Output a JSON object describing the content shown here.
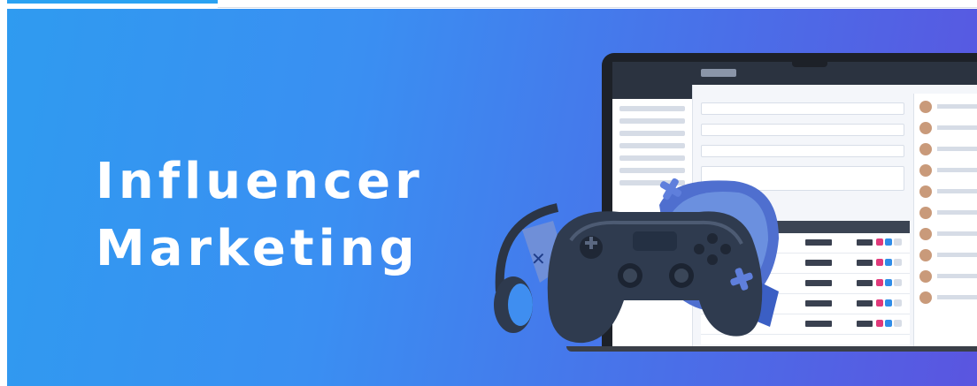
{
  "headline": {
    "line1": "Influencer",
    "line2": "Marketing"
  },
  "colors": {
    "accent_tab": "#2aa2f2",
    "banner_start": "#2f9bf0",
    "banner_end": "#5a55e0",
    "headline_text": "#ffffff"
  },
  "illustration": {
    "objects": [
      "laptop-dashboard",
      "game-controller",
      "headphones",
      "vr-headset"
    ]
  }
}
